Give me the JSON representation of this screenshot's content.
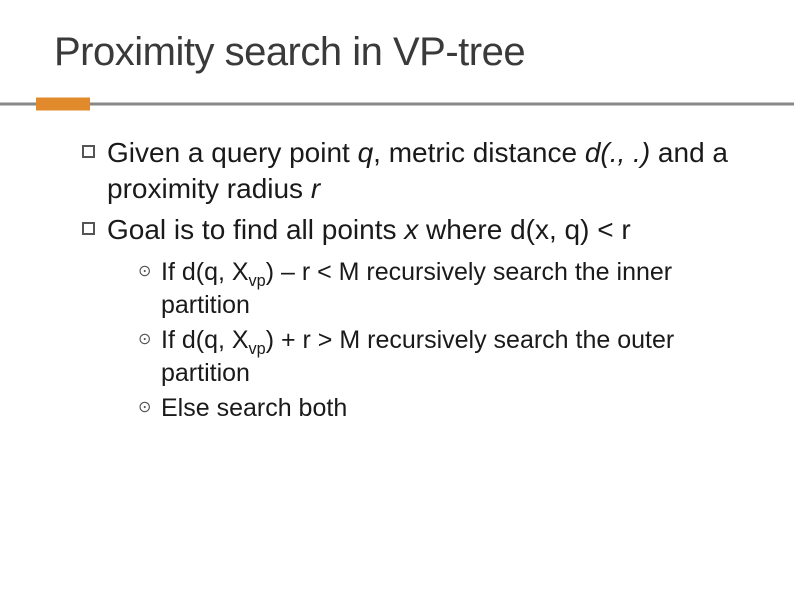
{
  "title": "Proximity search in VP-tree",
  "bullets": [
    {
      "parts": [
        {
          "t": "Given a query point "
        },
        {
          "t": "q",
          "italic": true
        },
        {
          "t": ", metric distance "
        },
        {
          "t": "d(., .)",
          "italic": true
        },
        {
          "t": " and a proximity radius "
        },
        {
          "t": "r",
          "italic": true
        }
      ]
    },
    {
      "parts": [
        {
          "t": "Goal is to find all points "
        },
        {
          "t": "x",
          "italic": true
        },
        {
          "t": " where d(x, q) < r"
        }
      ]
    }
  ],
  "sub_bullets": [
    {
      "parts": [
        {
          "t": "If d(q, X"
        },
        {
          "t": "vp",
          "sub": true
        },
        {
          "t": ") – r < M recursively search the inner partition"
        }
      ]
    },
    {
      "parts": [
        {
          "t": "If d(q, X"
        },
        {
          "t": "vp",
          "sub": true
        },
        {
          "t": ") + r > M recursively search the outer partition"
        }
      ]
    },
    {
      "parts": [
        {
          "t": "Else search both"
        }
      ]
    }
  ]
}
